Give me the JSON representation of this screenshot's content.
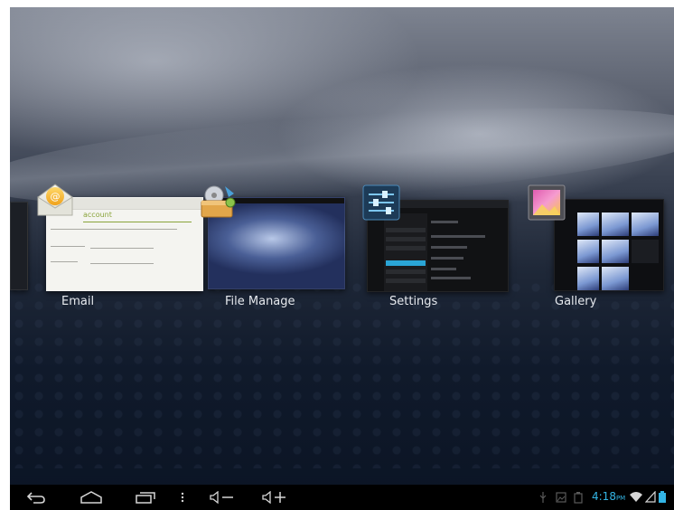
{
  "recent_apps": [
    {
      "label": "Email",
      "icon": "email-envelope-icon"
    },
    {
      "label": "File Manage",
      "icon": "file-manager-icon"
    },
    {
      "label": "Settings",
      "icon": "settings-sliders-icon"
    },
    {
      "label": "Gallery",
      "icon": "gallery-photo-icon"
    }
  ],
  "email_preview": {
    "title": "account"
  },
  "status_bar": {
    "time": "4:18",
    "ampm": "PM"
  },
  "colors": {
    "accent": "#33b5e5",
    "settings_selection": "#2aa5d6",
    "email_title": "#8aa43b"
  }
}
